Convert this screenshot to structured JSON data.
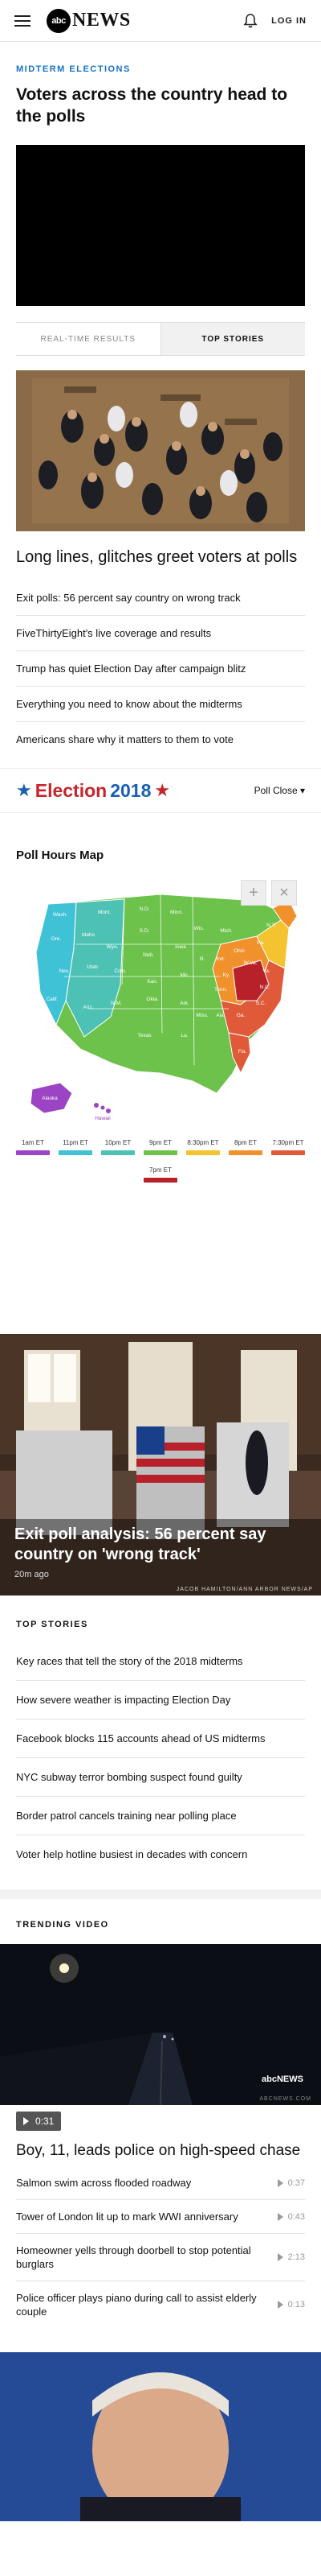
{
  "header": {
    "logo_badge": "abc",
    "logo_word": "NEWS",
    "login_label": "LOG IN",
    "bell_icon": "bell-icon",
    "menu_icon": "hamburger-icon"
  },
  "feature": {
    "kicker": "MIDTERM ELECTIONS",
    "headline": "Voters across the country head to the polls"
  },
  "tabs": [
    "REAL-TIME RESULTS",
    "TOP STORIES"
  ],
  "lead_story": {
    "title": "Long lines, glitches greet voters at polls",
    "links": [
      "Exit polls: 56 percent say country on wrong track",
      "FiveThirtyEight's live coverage and results",
      "Trump has quiet Election Day after campaign blitz",
      "Everything you need to know about the midterms",
      "Americans share why it matters to them to vote"
    ]
  },
  "election_bar": {
    "title": "Election",
    "year": "2018",
    "poll_select": "Poll Close"
  },
  "poll_map": {
    "label": "Poll Hours Map",
    "zoom_in": "+",
    "zoom_out": "×",
    "state_labels": [
      "Wash.",
      "Mont.",
      "N.D.",
      "Minn.",
      "Ore.",
      "Idaho",
      "Wyo.",
      "S.D.",
      "Wis.",
      "Mich.",
      "N.Y.",
      "Nev.",
      "Utah",
      "Colo.",
      "Neb.",
      "Iowa",
      "Ill.",
      "Ind.",
      "Ohio",
      "Pa.",
      "Calif.",
      "Ariz.",
      "N.M.",
      "Kan.",
      "Mo.",
      "Ky.",
      "W.Va.",
      "Va.",
      "Okla.",
      "Ark.",
      "Tenn.",
      "N.C.",
      "Texas",
      "La.",
      "Miss.",
      "Ala.",
      "Ga.",
      "S.C.",
      "Fla.",
      "Alaska",
      "Hawaii"
    ],
    "legend": [
      {
        "label": "1am ET",
        "color": "#9b44c4"
      },
      {
        "label": "11pm ET",
        "color": "#3fc1d6"
      },
      {
        "label": "10pm ET",
        "color": "#4dc2b4"
      },
      {
        "label": "9pm ET",
        "color": "#6cc24a"
      },
      {
        "label": "8:30pm ET",
        "color": "#f4c430"
      },
      {
        "label": "8pm ET",
        "color": "#f0912b"
      },
      {
        "label": "7:30pm ET",
        "color": "#e05a3a"
      },
      {
        "label": "7pm ET",
        "color": "#b8202a"
      }
    ]
  },
  "exit_poll": {
    "caption": "Exit poll analysis: 56 percent say country on 'wrong track'",
    "time": "20m ago",
    "credit": "JACOB HAMILTON/ANN ARBOR NEWS/AP"
  },
  "top_stories": {
    "label": "TOP STORIES",
    "items": [
      "Key races that tell the story of the 2018 midterms",
      "How severe weather is impacting Election Day",
      "Facebook blocks 115 accounts ahead of US midterms",
      "NYC subway terror bombing suspect found guilty",
      "Border patrol cancels training near polling place",
      "Voter help hotline busiest in decades with concern"
    ]
  },
  "trending": {
    "label": "TRENDING VIDEO",
    "watermark": "abcNEWS",
    "watermark_url": "ABCNEWS.COM",
    "duration": "0:31",
    "title": "Boy, 11, leads police on high-speed chase",
    "items": [
      {
        "title": "Salmon swim across flooded roadway",
        "duration": "0:37"
      },
      {
        "title": "Tower of London lit up to mark WWI anniversary",
        "duration": "0:43"
      },
      {
        "title": "Homeowner yells through doorbell to stop potential burglars",
        "duration": "2:13"
      },
      {
        "title": "Police officer plays piano during call to assist elderly couple",
        "duration": "0:13"
      }
    ]
  }
}
